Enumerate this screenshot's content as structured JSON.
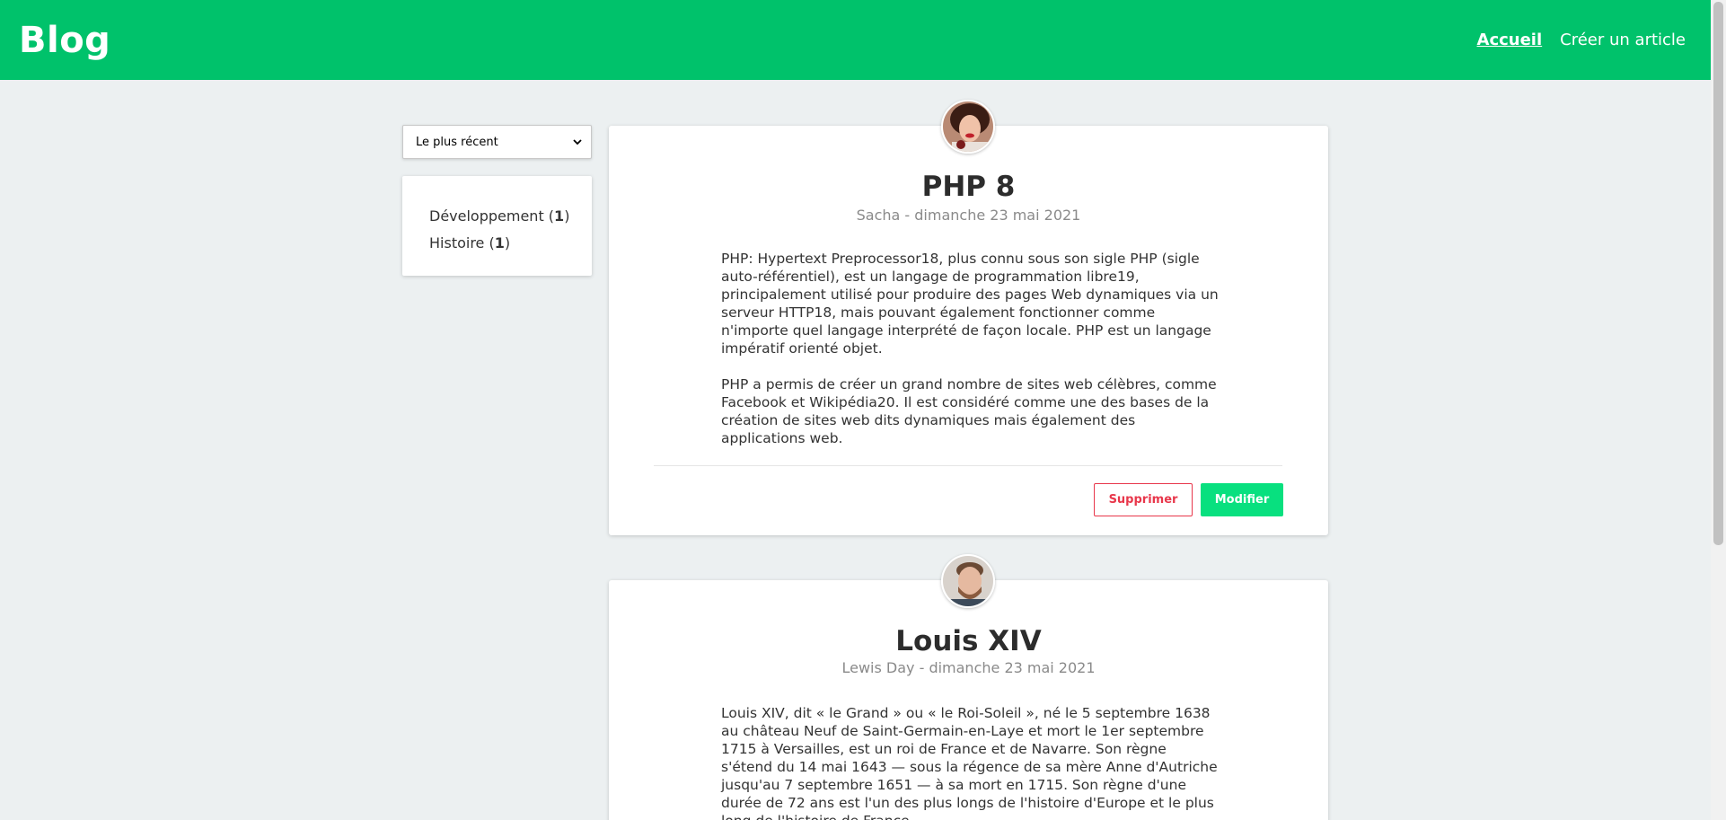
{
  "header": {
    "brand": "Blog",
    "nav": [
      {
        "label": "Accueil",
        "active": true
      },
      {
        "label": "Créer un article",
        "active": false
      }
    ]
  },
  "sidebar": {
    "sort_selected": "Le plus récent",
    "categories": [
      {
        "name": "Développement",
        "count": "1"
      },
      {
        "name": "Histoire",
        "count": "1"
      }
    ]
  },
  "articles": [
    {
      "title": "PHP 8",
      "meta": "Sacha - dimanche 23 mai 2021",
      "paragraphs": [
        "PHP: Hypertext Preprocessor18, plus connu sous son sigle PHP (sigle auto-référentiel), est un langage de programmation libre19, principalement utilisé pour produire des pages Web dynamiques via un serveur HTTP18, mais pouvant également fonctionner comme n'importe quel langage interprété de façon locale. PHP est un langage impératif orienté objet.",
        "PHP a permis de créer un grand nombre de sites web célèbres, comme Facebook et Wikipédia20. Il est considéré comme une des bases de la création de sites web dits dynamiques mais également des applications web."
      ],
      "delete_label": "Supprimer",
      "edit_label": "Modifier"
    },
    {
      "title": "Louis XIV",
      "meta": "Lewis Day - dimanche 23 mai 2021",
      "paragraphs": [
        "Louis XIV, dit « le Grand » ou « le Roi-Soleil », né le 5 septembre 1638 au château Neuf de Saint-Germain-en-Laye et mort le 1er septembre 1715 à Versailles, est un roi de France et de Navarre. Son règne s'étend du 14 mai 1643 — sous la régence de sa mère Anne d'Autriche jusqu'au 7 septembre 1651 — à sa mort en 1715. Son règne d'une durée de 72 ans est l'un des plus longs de l'histoire d'Europe et le plus long de l'histoire de France."
      ]
    }
  ],
  "colors": {
    "brand_green": "#00c26b",
    "edit_green": "#08e07f",
    "delete_red": "#e8374b",
    "background": "#ecf0f1"
  },
  "icons": [
    "avatar-sacha",
    "avatar-lewis-day",
    "chevron-down-icon"
  ]
}
